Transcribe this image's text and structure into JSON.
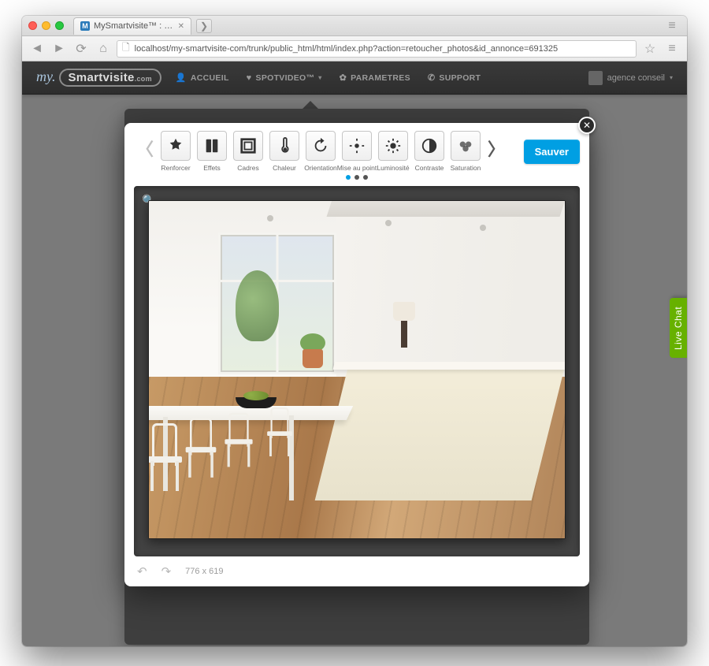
{
  "browser": {
    "tab_title": "MySmartvisite™ : Retouch…",
    "url": "localhost/my-smartvisite-com/trunk/public_html/html/index.php?action=retoucher_photos&id_annonce=691325"
  },
  "header": {
    "logo_prefix": "my.",
    "logo_brand": "Smartvisite",
    "logo_suffix": ".com",
    "nav": {
      "accueil": "ACCUEIL",
      "spotvideo": "SPOTVIDEO™",
      "parametres": "PARAMETRES",
      "support": "SUPPORT"
    },
    "user_label": "agence conseil"
  },
  "editor": {
    "tools": {
      "renforcer": "Renforcer",
      "effets": "Effets",
      "cadres": "Cadres",
      "chaleur": "Chaleur",
      "orientation": "Orientation",
      "mise_au_point": "Mise au point",
      "luminosite": "Luminosité",
      "contraste": "Contraste",
      "saturation": "Saturation"
    },
    "save_label": "Sauver",
    "dimensions": "776 x 619"
  },
  "live_chat": "Live Chat"
}
